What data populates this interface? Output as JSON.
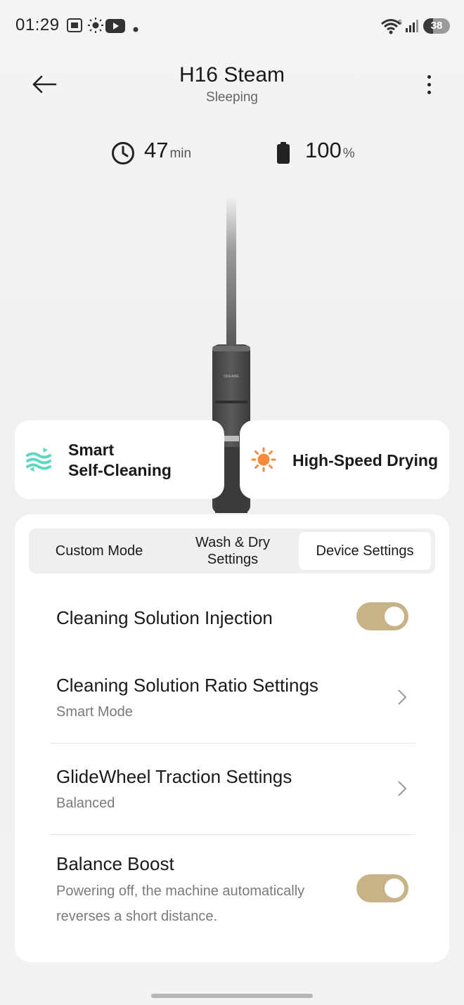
{
  "status_bar": {
    "time": "01:29",
    "battery_level": "38",
    "icons": [
      "screenshot-icon",
      "brightness-icon",
      "youtube-icon",
      "notification-dot-icon",
      "wifi-icon",
      "signal-icon",
      "battery-icon"
    ]
  },
  "header": {
    "title": "H16 Steam",
    "subtitle": "Sleeping"
  },
  "stats": {
    "time_value": "47",
    "time_unit": "min",
    "battery_value": "100",
    "battery_unit": "%"
  },
  "features": {
    "self_cleaning_label": "Smart\nSelf-Cleaning",
    "drying_label": "High-Speed Drying"
  },
  "tabs": {
    "custom_mode": "Custom Mode",
    "wash_dry": "Wash & Dry\nSettings",
    "device_settings": "Device Settings",
    "active": "Device Settings"
  },
  "settings": {
    "injection": {
      "title": "Cleaning Solution Injection",
      "enabled": true
    },
    "ratio": {
      "title": "Cleaning Solution Ratio Settings",
      "value": "Smart Mode"
    },
    "traction": {
      "title": "GlideWheel Traction Settings",
      "value": "Balanced"
    },
    "boost": {
      "title": "Balance Boost",
      "description": "Powering off, the machine automatically reverses a short distance.",
      "enabled": true
    }
  },
  "colors": {
    "toggle_on": "#c8b288",
    "self_clean_icon": "#5fd8c0",
    "drying_icon": "#f58a3c"
  }
}
